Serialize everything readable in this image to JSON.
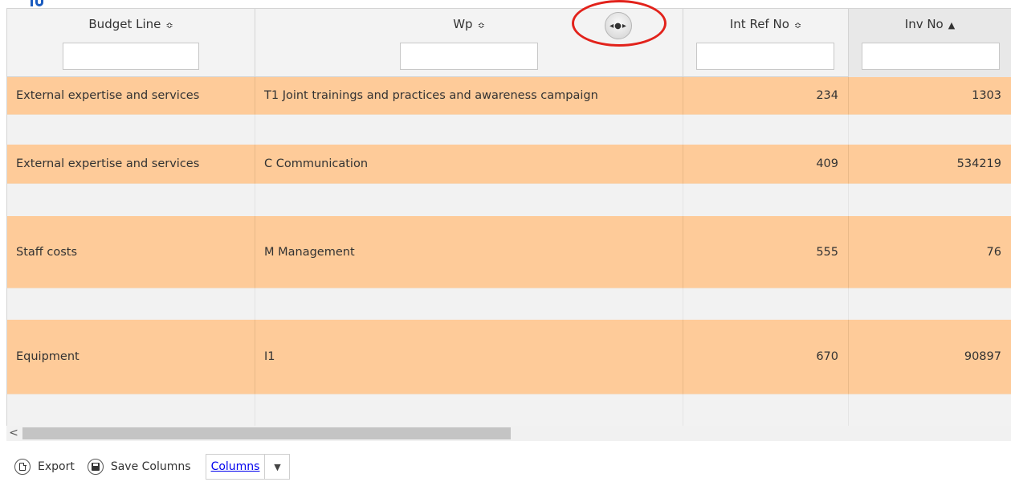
{
  "table": {
    "columns": [
      {
        "label": "Budget Line",
        "sort_icon": "⇕",
        "sorted": false
      },
      {
        "label": "Wp",
        "sort_icon": "⇕",
        "sorted": false
      },
      {
        "label": "Int Ref No",
        "sort_icon": "⇕",
        "sorted": false
      },
      {
        "label": "Inv No",
        "sort_icon": "▲",
        "sorted": true
      }
    ],
    "sort_glyph": "≎",
    "sorted_glyph": "▲",
    "rows": [
      {
        "budget_line": "External expertise and services",
        "wp": "T1 Joint trainings and practices and awareness campaign",
        "int_ref_no": "234",
        "inv_no": "1303"
      },
      {
        "budget_line": "External expertise and services",
        "wp": "C Communication",
        "int_ref_no": "409",
        "inv_no": "534219"
      },
      {
        "budget_line": "Staff costs",
        "wp": "M Management",
        "int_ref_no": "555",
        "inv_no": "76"
      },
      {
        "budget_line": "Equipment",
        "wp": "I1",
        "int_ref_no": "670",
        "inv_no": "90897"
      }
    ],
    "row_color": "#fecb99",
    "spacer_color": "#f2f2f2"
  },
  "resize_handle": {
    "glyph": "◂●▸",
    "icon": "column-resize-icon",
    "highlight_color": "#e2221b"
  },
  "scrollbar": {
    "left_arrow": "<"
  },
  "footer": {
    "export_label": "Export",
    "save_columns_label": "Save Columns",
    "columns_label": "Columns",
    "columns_caret": "▼"
  }
}
